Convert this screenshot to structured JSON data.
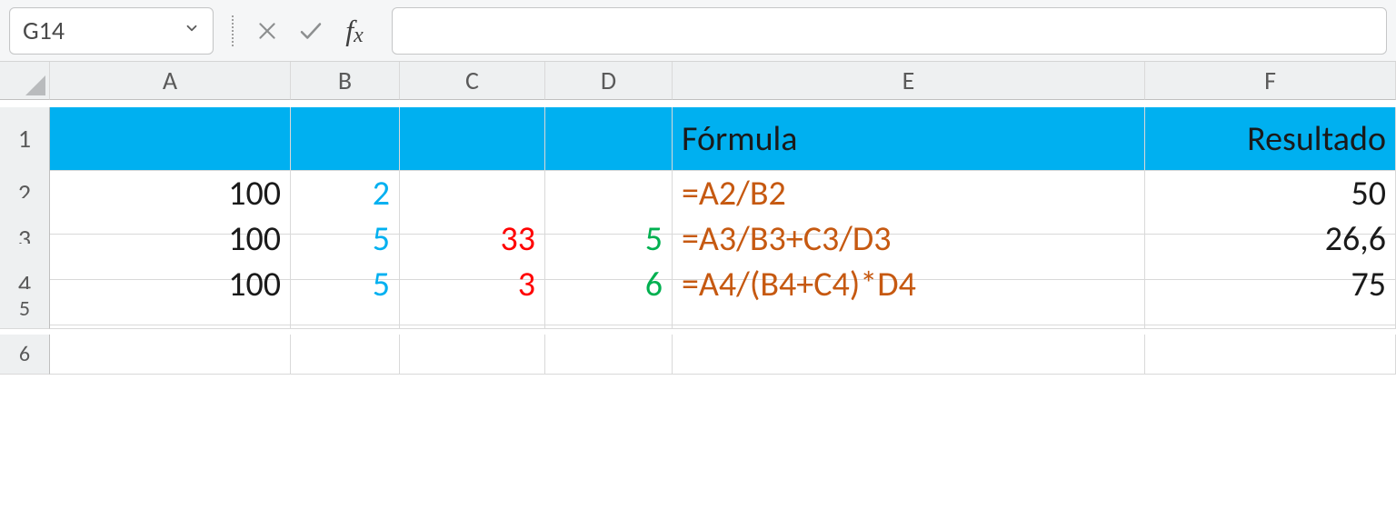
{
  "formula_bar": {
    "name_box": "G14",
    "formula_input": ""
  },
  "columns": [
    "A",
    "B",
    "C",
    "D",
    "E",
    "F"
  ],
  "row_headers": [
    "1",
    "2",
    "3",
    "4",
    "5",
    "6"
  ],
  "header_row": {
    "E": "Fórmula",
    "F": "Resultado"
  },
  "rows": [
    {
      "A": "100",
      "B": "2",
      "C": "",
      "D": "",
      "E": "=A2/B2",
      "F": "50"
    },
    {
      "A": "100",
      "B": "5",
      "C": "33",
      "D": "5",
      "E": "=A3/B3+C3/D3",
      "F": "26,6"
    },
    {
      "A": "100",
      "B": "5",
      "C": "3",
      "D": "6",
      "E": "=A4/(B4+C4)*D4",
      "F": "75"
    }
  ],
  "colors": {
    "A": "c-black",
    "B": "c-blue",
    "C": "c-red",
    "D": "c-green",
    "E": "c-orange",
    "F": "c-black"
  }
}
